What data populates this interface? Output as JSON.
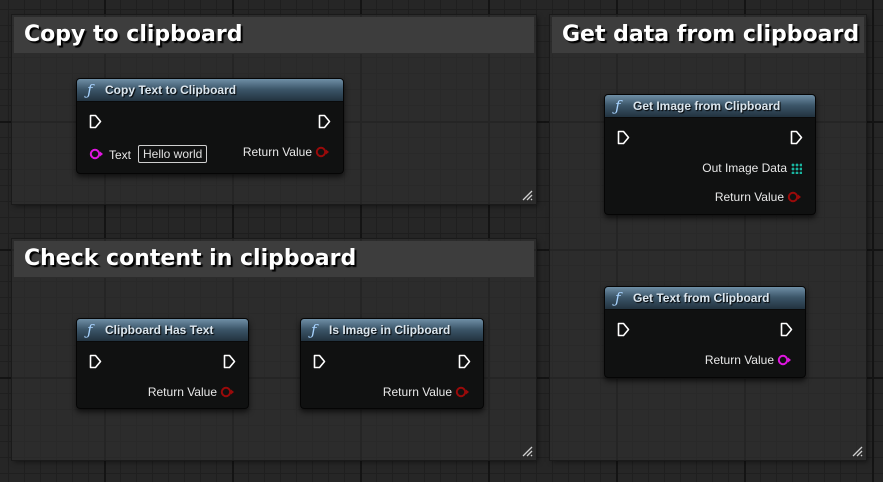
{
  "comments": {
    "copy": {
      "title": "Copy to clipboard"
    },
    "check": {
      "title": "Check content in clipboard"
    },
    "get": {
      "title": "Get data from clipboard"
    }
  },
  "nodes": {
    "copy_text": {
      "title": "Copy Text to Clipboard",
      "text_pin_label": "Text",
      "text_value": "Hello world",
      "return_label": "Return Value"
    },
    "has_text": {
      "title": "Clipboard Has Text",
      "return_label": "Return Value"
    },
    "is_image": {
      "title": "Is Image in Clipboard",
      "return_label": "Return Value"
    },
    "get_image": {
      "title": "Get Image from Clipboard",
      "out_image_label": "Out Image Data",
      "return_label": "Return Value"
    },
    "get_text": {
      "title": "Get Text from Clipboard",
      "return_label": "Return Value"
    }
  },
  "colors": {
    "bool_pin": "#9a0a0a",
    "string_pin": "#e016e0",
    "struct_pin": "#19b5a0",
    "node_header": "#3b5568",
    "function_icon": "#a7d3ff"
  }
}
